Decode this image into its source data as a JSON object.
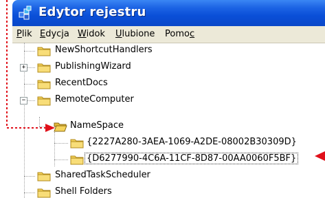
{
  "window": {
    "title": "Edytor rejestru"
  },
  "menu": [
    {
      "first": "P",
      "rest": "lik"
    },
    {
      "first": "E",
      "rest": "dycja"
    },
    {
      "first": "W",
      "rest": "idok"
    },
    {
      "first": "U",
      "rest": "lubione"
    },
    {
      "pre": "Pomo",
      "first": "c",
      "rest": ""
    }
  ],
  "tree": {
    "items": [
      {
        "label": "NewShortcutHandlers"
      },
      {
        "label": "PublishingWizard",
        "expander": "+"
      },
      {
        "label": "RecentDocs"
      },
      {
        "label": "RemoteComputer",
        "expander": "−"
      },
      {
        "label": "NameSpace",
        "open": true
      },
      {
        "label": "{2227A280-3AEA-1069-A2DE-08002B30309D}"
      },
      {
        "label": "{D6277990-4C6A-11CF-8D87-00AA0060F5BF}",
        "focused": true
      },
      {
        "label": "SharedTaskScheduler"
      },
      {
        "label": "Shell Folders"
      }
    ]
  },
  "colors": {
    "titlebar": "#0a4fd8",
    "annotation_arrow": "#e0101a",
    "folder_yellow": "#f5d35a"
  }
}
